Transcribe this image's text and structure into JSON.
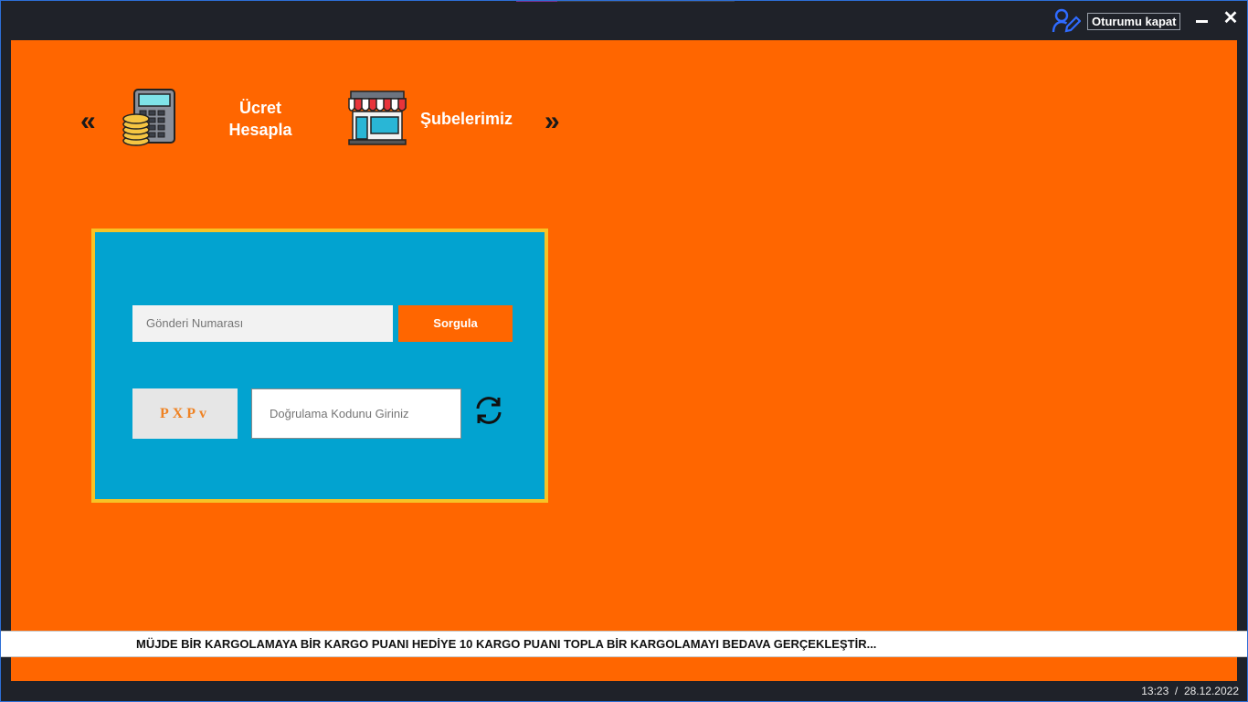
{
  "titlebar": {
    "logout_label": "Oturumu kapat",
    "icons": {
      "user": "user-edit-icon",
      "minimize": "minimize-icon",
      "close": "close-icon"
    },
    "close_glyph": "✕"
  },
  "nav": {
    "prev_glyph": "«",
    "next_glyph": "»",
    "items": [
      {
        "label": "Ücret Hesapla",
        "icon": "calculator-coins-icon"
      },
      {
        "label": "Şubelerimiz",
        "icon": "store-icon"
      }
    ]
  },
  "query_panel": {
    "tracking_placeholder": "Gönderi Numarası",
    "search_button": "Sorgula",
    "captcha_text": "PXPv",
    "code_placeholder": "Doğrulama Kodunu Giriniz",
    "refresh_icon": "refresh-icon"
  },
  "marquee": {
    "text": "MÜJDE BİR KARGOLAMAYA BİR KARGO PUANI HEDİYE 10 KARGO PUANI TOPLA BİR KARGOLAMAYI BEDAVA GERÇEKLEŞTİR..."
  },
  "status": {
    "time": "13:23",
    "separator": "/",
    "date": "28.12.2022"
  },
  "colors": {
    "main_bg": "#ff6600",
    "frame_bg": "#1f2229",
    "panel_bg": "#02a3d0",
    "panel_border": "#f7c325",
    "button": "#ff6600",
    "captcha_text": "#ef8222"
  }
}
